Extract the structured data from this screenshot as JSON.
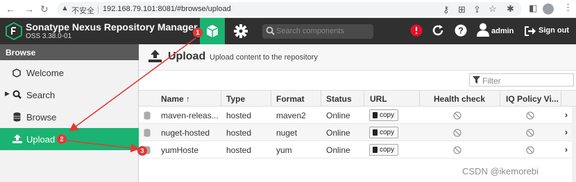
{
  "browser": {
    "insecure_label": "不安全",
    "url": "192.168.79.101:8081/#browse/upload"
  },
  "header": {
    "app_name": "Sonatype Nexus Repository Manager",
    "version": "OSS 3.38.0-01",
    "search_placeholder": "Search components",
    "user_name": "admin",
    "signout_label": "Sign out"
  },
  "sidebar": {
    "title": "Browse",
    "items": [
      {
        "label": "Welcome"
      },
      {
        "label": "Search"
      },
      {
        "label": "Browse"
      },
      {
        "label": "Upload"
      }
    ]
  },
  "main": {
    "title": "Upload",
    "subtitle": "Upload content to the repository",
    "filter_placeholder": "Filter",
    "columns": [
      "Name ↑",
      "Type",
      "Format",
      "Status",
      "URL",
      "Health check",
      "IQ Policy Vi..."
    ],
    "rows": [
      {
        "name": "maven-releas...",
        "type": "hosted",
        "format": "maven2",
        "status": "Online",
        "url_button": "copy"
      },
      {
        "name": "nuget-hosted",
        "type": "hosted",
        "format": "nuget",
        "status": "Online",
        "url_button": "copy"
      },
      {
        "name": "yumHoste",
        "type": "hosted",
        "format": "yum",
        "status": "Online",
        "url_button": "copy"
      }
    ]
  },
  "annotations": {
    "badges": [
      "1",
      "2",
      "3"
    ],
    "color": "#e53935"
  },
  "watermark": "CSDN @ikemorebi",
  "colors": {
    "accent": "#1bb371",
    "header_bg": "#303030",
    "alert": "#e8102a"
  }
}
